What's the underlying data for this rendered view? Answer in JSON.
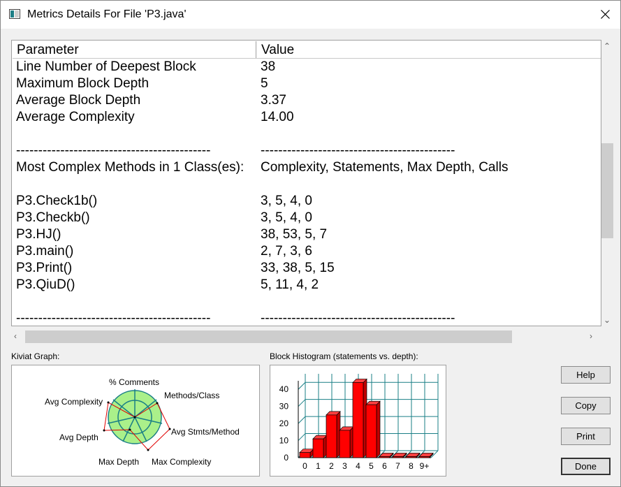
{
  "window": {
    "title": "Metrics Details For File 'P3.java'"
  },
  "table": {
    "columns": [
      "Parameter",
      "Value"
    ],
    "rows": [
      [
        "Line Number of Deepest Block",
        "38"
      ],
      [
        "Maximum Block Depth",
        "5"
      ],
      [
        "Average Block Depth",
        "3.37"
      ],
      [
        "Average Complexity",
        "14.00"
      ],
      [
        "",
        ""
      ],
      [
        "--------------------------------------------",
        "--------------------------------------------"
      ],
      [
        "Most Complex Methods in 1 Class(es):",
        "Complexity, Statements, Max Depth, Calls"
      ],
      [
        "",
        ""
      ],
      [
        "P3.Check1b()",
        "3, 5, 4, 0"
      ],
      [
        "P3.Checkb()",
        "3, 5, 4, 0"
      ],
      [
        "P3.HJ()",
        "38, 53, 5, 7"
      ],
      [
        "P3.main()",
        "2, 7, 3, 6"
      ],
      [
        "P3.Print()",
        "33, 38, 5, 15"
      ],
      [
        "P3.QiuD()",
        "5, 11, 4, 2"
      ],
      [
        "",
        ""
      ],
      [
        "--------------------------------------------",
        "--------------------------------------------"
      ]
    ]
  },
  "kiviat": {
    "label": "Kiviat Graph:",
    "axes": [
      "% Comments",
      "Methods/Class",
      "Avg Stmts/Method",
      "Max Complexity",
      "Max Depth",
      "Avg Depth",
      "Avg Complexity"
    ]
  },
  "histogram": {
    "label": "Block Histogram (statements vs. depth):",
    "y_ticks": [
      "0",
      "10",
      "20",
      "30",
      "40"
    ],
    "categories": [
      "0",
      "1",
      "2",
      "3",
      "4",
      "5",
      "6",
      "7",
      "8",
      "9+"
    ]
  },
  "chart_data": {
    "type": "bar",
    "title": "Block Histogram (statements vs. depth):",
    "categories": [
      "0",
      "1",
      "2",
      "3",
      "4",
      "5",
      "6",
      "7",
      "8",
      "9+"
    ],
    "values": [
      3,
      11,
      25,
      16,
      44,
      31,
      0,
      0,
      0,
      0
    ],
    "ylim": [
      0,
      45
    ]
  },
  "buttons": {
    "help": "Help",
    "copy": "Copy",
    "print": "Print",
    "done": "Done"
  },
  "colors": {
    "bar": "#ff0000",
    "grid": "#1a7f86",
    "kiviat_fill": "#aaf08a"
  }
}
